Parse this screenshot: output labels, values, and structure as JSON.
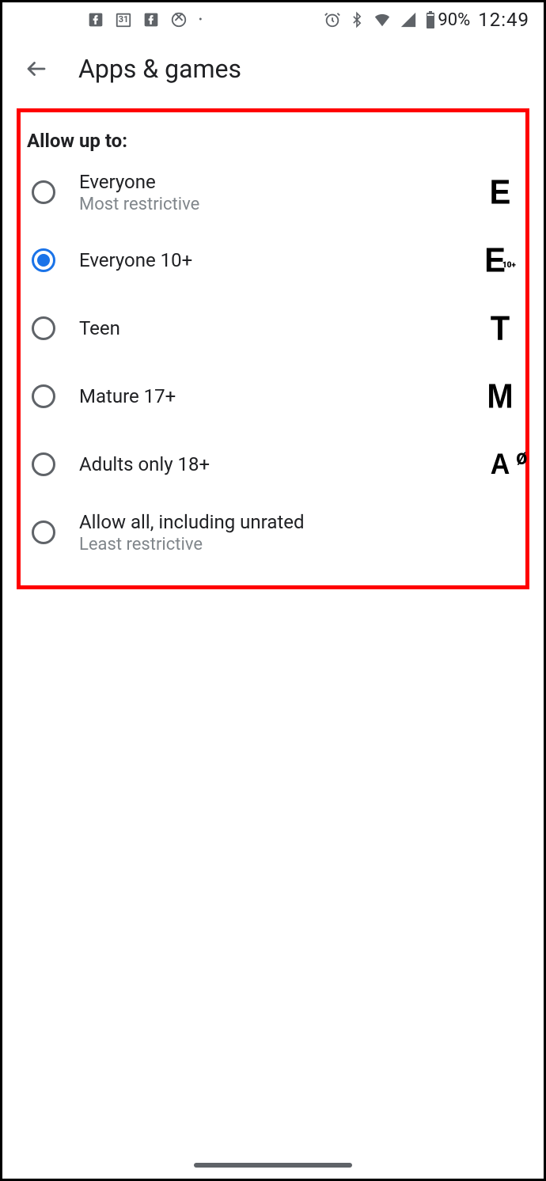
{
  "statusbar": {
    "calendar_date": "31",
    "battery_text": "90%",
    "clock": "12:49"
  },
  "appbar": {
    "title": "Apps & games"
  },
  "section": {
    "heading": "Allow up to:"
  },
  "options": [
    {
      "title": "Everyone",
      "subtitle": "Most restrictive",
      "rating_letter": "E",
      "rating_sub": "",
      "selected": false
    },
    {
      "title": "Everyone 10+",
      "subtitle": "",
      "rating_letter": "E",
      "rating_sub": "10+",
      "selected": true
    },
    {
      "title": "Teen",
      "subtitle": "",
      "rating_letter": "T",
      "rating_sub": "",
      "selected": false
    },
    {
      "title": "Mature 17+",
      "subtitle": "",
      "rating_letter": "M",
      "rating_sub": "",
      "selected": false
    },
    {
      "title": "Adults only 18+",
      "subtitle": "",
      "rating_letter": "AO",
      "rating_sub": "",
      "selected": false
    },
    {
      "title": "Allow all, including unrated",
      "subtitle": "Least restrictive",
      "rating_letter": "",
      "rating_sub": "",
      "selected": false
    }
  ]
}
